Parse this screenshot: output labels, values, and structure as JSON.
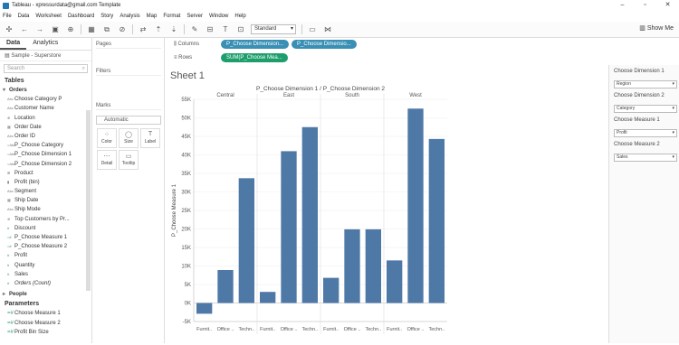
{
  "window": {
    "title": "Tableau - xpressurdata@gmail.com Template"
  },
  "menu": [
    "File",
    "Data",
    "Worksheet",
    "Dashboard",
    "Story",
    "Analysis",
    "Map",
    "Format",
    "Server",
    "Window",
    "Help"
  ],
  "toolbar": {
    "fit": "Standard",
    "show_me": "Show Me"
  },
  "left_pane": {
    "tabs": [
      "Data",
      "Analytics"
    ],
    "datasource": "Sample - Superstore",
    "search_placeholder": "Search",
    "tables_header": "Tables",
    "orders": "Orders",
    "fields": [
      {
        "name": "Choose Category P",
        "kind": "dim",
        "icon": "Abc"
      },
      {
        "name": "Customer Name",
        "kind": "dim",
        "icon": "Abc"
      },
      {
        "name": "Location",
        "kind": "dim",
        "icon": "⊕"
      },
      {
        "name": "Order Date",
        "kind": "dim",
        "icon": "▦"
      },
      {
        "name": "Order ID",
        "kind": "dim",
        "icon": "Abc"
      },
      {
        "name": "P_Choose Category",
        "kind": "dim",
        "icon": "=Abc"
      },
      {
        "name": "P_Choose Dimension 1",
        "kind": "dim",
        "icon": "=Abc"
      },
      {
        "name": "P_Choose Dimension 2",
        "kind": "dim",
        "icon": "=Abc"
      },
      {
        "name": "Product",
        "kind": "dim",
        "icon": "⊞"
      },
      {
        "name": "Profit (bin)",
        "kind": "dim",
        "icon": "▮"
      },
      {
        "name": "Segment",
        "kind": "dim",
        "icon": "Abc"
      },
      {
        "name": "Ship Date",
        "kind": "dim",
        "icon": "▦"
      },
      {
        "name": "Ship Mode",
        "kind": "dim",
        "icon": "Abc"
      },
      {
        "name": "Top Customers by Pr...",
        "kind": "dim",
        "icon": "⊚"
      },
      {
        "name": "Discount",
        "kind": "measure",
        "icon": "#"
      },
      {
        "name": "P_Choose Measure 1",
        "kind": "measure",
        "icon": "=#"
      },
      {
        "name": "P_Choose Measure 2",
        "kind": "measure",
        "icon": "=#"
      },
      {
        "name": "Profit",
        "kind": "measure",
        "icon": "#"
      },
      {
        "name": "Quantity",
        "kind": "measure",
        "icon": "#"
      },
      {
        "name": "Sales",
        "kind": "measure",
        "icon": "#"
      },
      {
        "name": "Orders (Count)",
        "kind": "measure",
        "icon": "#",
        "italic": true
      }
    ],
    "people": "People",
    "parameters_header": "Parameters",
    "parameters": [
      "Choose Measure 1",
      "Choose Measure 2",
      "Profit Bin Size"
    ]
  },
  "cards": {
    "pages": "Pages",
    "filters": "Filters",
    "marks": "Marks",
    "mark_type": "Automatic",
    "buttons": [
      {
        "label": "Color",
        "icon": "⁘"
      },
      {
        "label": "Size",
        "icon": "◯"
      },
      {
        "label": "Label",
        "icon": "T"
      },
      {
        "label": "Detail",
        "icon": "⋯"
      },
      {
        "label": "Tooltip",
        "icon": "▭"
      }
    ]
  },
  "shelves": {
    "columns_label": "Columns",
    "rows_label": "Rows",
    "columns_pills": [
      "P_Choose Dimension...",
      "P_Choose Dimensio..."
    ],
    "rows_pills": [
      "SUM(P_Choose Mea..."
    ]
  },
  "sheet": {
    "title": "Sheet 1"
  },
  "chart_data": {
    "type": "bar",
    "title": "P_Choose Dimension 1 / P_Choose Dimension 2",
    "ylabel": "P_Choose Measure 1",
    "ylim": [
      -5000,
      55000
    ],
    "yticks": [
      "-5K",
      "0K",
      "5K",
      "10K",
      "15K",
      "20K",
      "25K",
      "30K",
      "35K",
      "40K",
      "45K",
      "50K",
      "55K"
    ],
    "groups": [
      {
        "name": "Central",
        "categories": [
          "Furnit..",
          "Office ..",
          "Techn.."
        ],
        "values": [
          -2900,
          8900,
          33700
        ]
      },
      {
        "name": "East",
        "categories": [
          "Furnit..",
          "Office ..",
          "Techn.."
        ],
        "values": [
          3000,
          41000,
          47500
        ]
      },
      {
        "name": "South",
        "categories": [
          "Furnit..",
          "Office ..",
          "Techn.."
        ],
        "values": [
          6800,
          19900,
          19900
        ]
      },
      {
        "name": "West",
        "categories": [
          "Furnit..",
          "Office ..",
          "Techn.."
        ],
        "values": [
          11500,
          52500,
          44300
        ]
      }
    ],
    "bar_color": "#4e79a7"
  },
  "right_panel": {
    "params": [
      {
        "label": "Choose Dimension 1",
        "value": "Region"
      },
      {
        "label": "Choose Dimension 2",
        "value": "Category"
      },
      {
        "label": "Choose Measure 1",
        "value": "Profit"
      },
      {
        "label": "Choose Measure 2",
        "value": "Sales"
      }
    ]
  }
}
